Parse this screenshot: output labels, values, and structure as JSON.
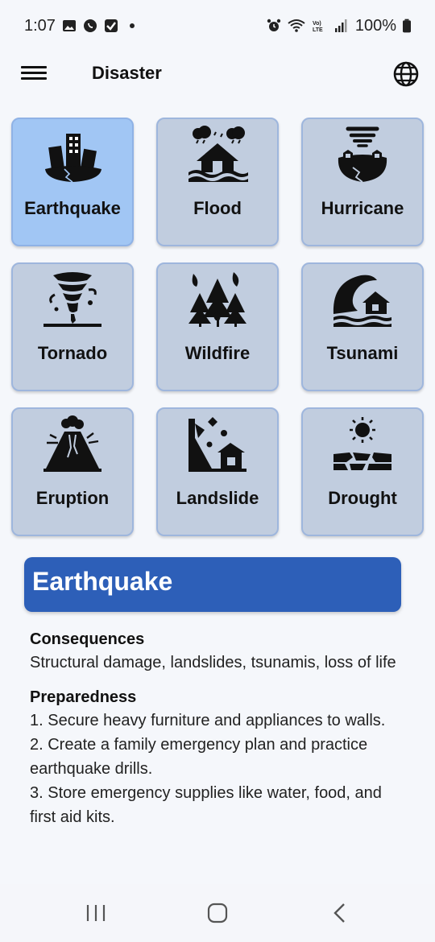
{
  "status_bar": {
    "time": "1:07",
    "battery": "100%",
    "lte_label": "VoLTE"
  },
  "app_bar": {
    "title": "Disaster",
    "menu_icon": "hamburger-menu-icon",
    "language_icon": "globe-icon"
  },
  "disasters": [
    {
      "label": "Earthquake",
      "icon": "earthquake-icon",
      "selected": true
    },
    {
      "label": "Flood",
      "icon": "flood-icon",
      "selected": false
    },
    {
      "label": "Hurricane",
      "icon": "hurricane-icon",
      "selected": false
    },
    {
      "label": "Tornado",
      "icon": "tornado-icon",
      "selected": false
    },
    {
      "label": "Wildfire",
      "icon": "wildfire-icon",
      "selected": false
    },
    {
      "label": "Tsunami",
      "icon": "tsunami-icon",
      "selected": false
    },
    {
      "label": "Eruption",
      "icon": "eruption-icon",
      "selected": false
    },
    {
      "label": "Landslide",
      "icon": "landslide-icon",
      "selected": false
    },
    {
      "label": "Drought",
      "icon": "drought-icon",
      "selected": false
    }
  ],
  "detail": {
    "title": "Earthquake",
    "consequences_heading": "Consequences",
    "consequences_text": "Structural damage, landslides, tsunamis, loss of life",
    "preparedness_heading": "Preparedness",
    "preparedness_items": [
      "1. Secure heavy furniture and appliances to walls.",
      "2. Create a family emergency plan and practice earthquake drills.",
      "3. Store emergency supplies like water, food, and first aid kits."
    ]
  },
  "colors": {
    "tile_bg": "#c1cddf",
    "tile_selected_bg": "#a1c6f4",
    "header_blue": "#2d5fb8"
  }
}
